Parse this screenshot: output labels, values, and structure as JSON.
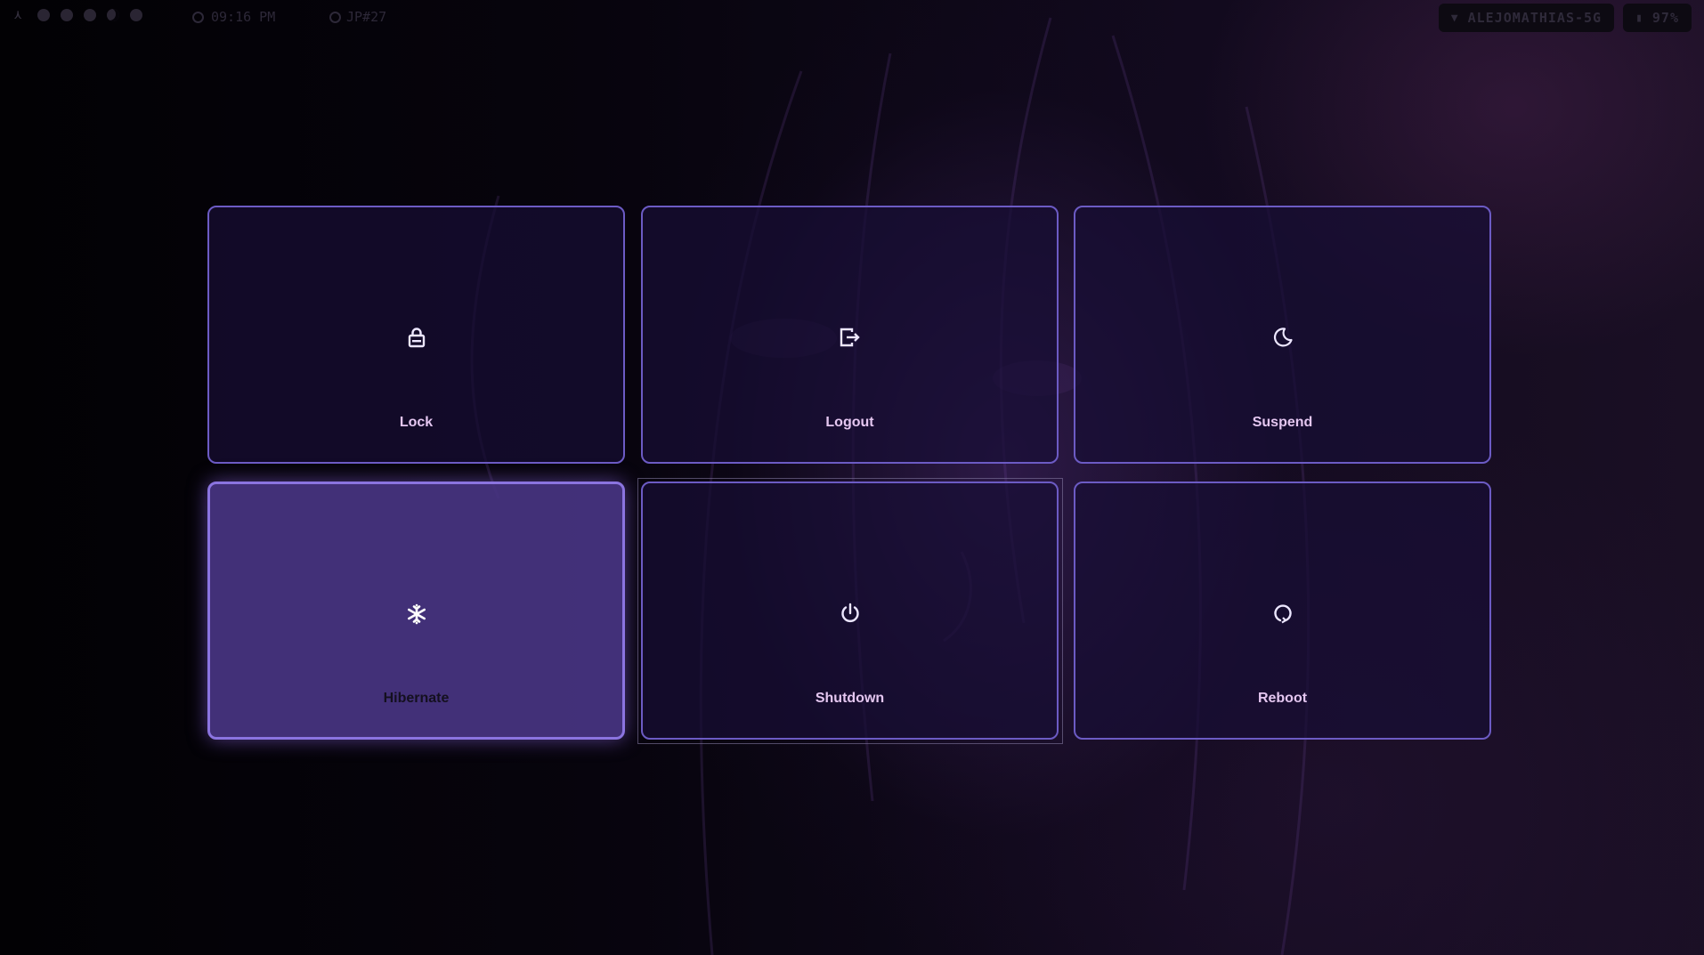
{
  "topbar": {
    "launcher_icon": "arch-icon",
    "workspaces": [
      "workspace-1",
      "workspace-2",
      "workspace-3",
      "workspace-4",
      "workspace-5",
      "workspace-6"
    ],
    "time": "09:16 PM",
    "workspace_label": "JP#27",
    "network_name": "ALEJOMATHIAS-5G",
    "battery": "97%"
  },
  "power_menu": {
    "items": [
      {
        "label": "Lock",
        "icon": "lock-icon"
      },
      {
        "label": "Logout",
        "icon": "logout-icon"
      },
      {
        "label": "Suspend",
        "icon": "moon-icon"
      },
      {
        "label": "Hibernate",
        "icon": "snowflake-icon"
      },
      {
        "label": "Shutdown",
        "icon": "power-icon"
      },
      {
        "label": "Reboot",
        "icon": "reboot-icon"
      }
    ],
    "selected": "Hibernate",
    "accent_color": "#6c5bc4",
    "selected_color": "#48348a",
    "label_color": "#e4c6f0"
  }
}
